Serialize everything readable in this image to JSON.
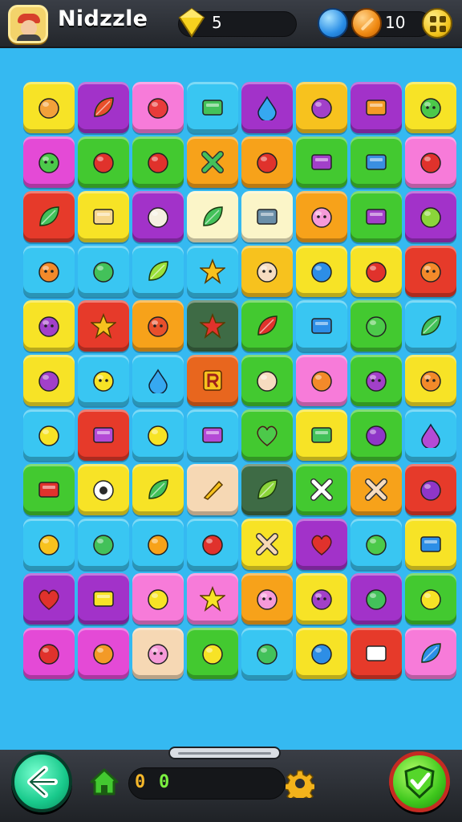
{
  "header": {
    "title": "Nidzzle",
    "gems": "5",
    "coins": "10",
    "avatar_icon": "player-avatar-icon",
    "gem_icon": "yellow-gem-icon",
    "blue_orb_icon": "blue-orb-icon",
    "coin_icon": "coin-icon",
    "menu_icon": "menu-grid-icon"
  },
  "footer": {
    "counter_a": "0",
    "counter_b": "0",
    "back_icon": "back-arrow-icon",
    "home_icon": "home-icon",
    "settings_icon": "gear-icon",
    "confirm_icon": "shield-check-icon"
  },
  "board": {
    "columns": 8,
    "rows": 11,
    "tiles": [
      {
        "bg": "#f7e326",
        "icon": "orange-ring",
        "color": "#f2a13a"
      },
      {
        "bg": "#a232c9",
        "icon": "red-leaf",
        "color": "#e84f2c"
      },
      {
        "bg": "#f77bd9",
        "icon": "red-fruit",
        "color": "#e83b3b"
      },
      {
        "bg": "#39c6f2",
        "icon": "green-card",
        "color": "#43c15a"
      },
      {
        "bg": "#a232c9",
        "icon": "water-drop",
        "color": "#36a8f0"
      },
      {
        "bg": "#f7c21e",
        "icon": "purple-gem",
        "color": "#a240c9"
      },
      {
        "bg": "#a232c9",
        "icon": "orange-bar",
        "color": "#f39a27"
      },
      {
        "bg": "#f7e326",
        "icon": "green-blob",
        "color": "#4cc94a"
      },
      {
        "bg": "#e44ad6",
        "icon": "green-blob",
        "color": "#4cc94a"
      },
      {
        "bg": "#43c930",
        "icon": "red-berry",
        "color": "#e0322c"
      },
      {
        "bg": "#43c930",
        "icon": "red-apple",
        "color": "#e0322c"
      },
      {
        "bg": "#f7a21a",
        "icon": "green-cross",
        "color": "#43c15a"
      },
      {
        "bg": "#f7a21a",
        "icon": "tomato",
        "color": "#e0322c"
      },
      {
        "bg": "#43c930",
        "icon": "purple-ticket",
        "color": "#a240c9"
      },
      {
        "bg": "#43c930",
        "icon": "juice-box",
        "color": "#3a8fe0"
      },
      {
        "bg": "#f77bd9",
        "icon": "red-seed",
        "color": "#e0322c"
      },
      {
        "bg": "#e63a2a",
        "icon": "green-leaf",
        "color": "#43c15a"
      },
      {
        "bg": "#f7e326",
        "icon": "butter-block",
        "color": "#f6d78d"
      },
      {
        "bg": "#a232c9",
        "icon": "garlic",
        "color": "#f5f0e0"
      },
      {
        "bg": "#fbf5c8",
        "icon": "green-leaf",
        "color": "#43c15a"
      },
      {
        "bg": "#fbf5c8",
        "icon": "tin-can",
        "color": "#6b8fa8"
      },
      {
        "bg": "#f7a21a",
        "icon": "pink-pig",
        "color": "#f59ad8"
      },
      {
        "bg": "#43c930",
        "icon": "purple-ticket",
        "color": "#a240c9"
      },
      {
        "bg": "#a232c9",
        "icon": "green-disc",
        "color": "#8bd43a"
      },
      {
        "bg": "#39c6f2",
        "icon": "orange-face",
        "color": "#f38a2a"
      },
      {
        "bg": "#39c6f2",
        "icon": "green-bubble",
        "color": "#43c15a"
      },
      {
        "bg": "#39c6f2",
        "icon": "green-leaf",
        "color": "#9ae03a"
      },
      {
        "bg": "#39c6f2",
        "icon": "gold-star",
        "color": "#f7c21e"
      },
      {
        "bg": "#f7c21e",
        "icon": "egg-face",
        "color": "#f6dcc0"
      },
      {
        "bg": "#f7e326",
        "icon": "blue-bubble",
        "color": "#2d8ee6"
      },
      {
        "bg": "#f7e326",
        "icon": "red-apple",
        "color": "#e0322c"
      },
      {
        "bg": "#e63a2a",
        "icon": "orange-face",
        "color": "#f38a2a"
      },
      {
        "bg": "#f7e326",
        "icon": "purple-blob",
        "color": "#a240c9"
      },
      {
        "bg": "#e63a2a",
        "icon": "gold-star",
        "color": "#f7c21e"
      },
      {
        "bg": "#f7a21a",
        "icon": "red-face",
        "color": "#e8502c"
      },
      {
        "bg": "#3e6b45",
        "icon": "red-star",
        "color": "#e0322c"
      },
      {
        "bg": "#43c930",
        "icon": "red-leaf",
        "color": "#e0322c"
      },
      {
        "bg": "#39c6f2",
        "icon": "envelope",
        "color": "#2d8ee6"
      },
      {
        "bg": "#43c930",
        "icon": "green-apple",
        "color": "#4cc94a"
      },
      {
        "bg": "#39c6f2",
        "icon": "pea-pod",
        "color": "#43c15a"
      },
      {
        "bg": "#f7e326",
        "icon": "purple-berry",
        "color": "#a240c9"
      },
      {
        "bg": "#39c6f2",
        "icon": "yellow-face",
        "color": "#f7e326"
      },
      {
        "bg": "#39c6f2",
        "icon": "water-drop",
        "color": "#36a8f0"
      },
      {
        "bg": "#e8661e",
        "icon": "letter-r",
        "color": "#f7c21e"
      },
      {
        "bg": "#43c930",
        "icon": "mushroom",
        "color": "#f6dcc0"
      },
      {
        "bg": "#f77bd9",
        "icon": "orange-pepper",
        "color": "#f38a2a"
      },
      {
        "bg": "#43c930",
        "icon": "purple-blob",
        "color": "#a240c9"
      },
      {
        "bg": "#f7e326",
        "icon": "orange-face",
        "color": "#f38a2a"
      },
      {
        "bg": "#39c6f2",
        "icon": "yellow-fish",
        "color": "#f7e326"
      },
      {
        "bg": "#e63a2a",
        "icon": "purple-candy",
        "color": "#b44ad6"
      },
      {
        "bg": "#39c6f2",
        "icon": "lemon",
        "color": "#f7e326"
      },
      {
        "bg": "#39c6f2",
        "icon": "purple-card",
        "color": "#b44ad6"
      },
      {
        "bg": "#43c930",
        "icon": "green-heart",
        "color": "#4cc94a"
      },
      {
        "bg": "#f7e326",
        "icon": "green-mail",
        "color": "#43c15a"
      },
      {
        "bg": "#43c930",
        "icon": "eggplant",
        "color": "#8f36c8"
      },
      {
        "bg": "#39c6f2",
        "icon": "purple-drop",
        "color": "#b44ad6"
      },
      {
        "bg": "#43c930",
        "icon": "red-slot",
        "color": "#e0322c"
      },
      {
        "bg": "#f7e326",
        "icon": "eyeball",
        "color": "#ffffff"
      },
      {
        "bg": "#f7e326",
        "icon": "green-leaf",
        "color": "#43c15a"
      },
      {
        "bg": "#f6d8b4",
        "icon": "pencil",
        "color": "#f7c21e"
      },
      {
        "bg": "#3e6b45",
        "icon": "green-leaf",
        "color": "#8bd43a"
      },
      {
        "bg": "#43c930",
        "icon": "white-cross",
        "color": "#ffffff"
      },
      {
        "bg": "#f7a21a",
        "icon": "tools",
        "color": "#f6dcc0"
      },
      {
        "bg": "#e63a2a",
        "icon": "purple-berry",
        "color": "#8f36c8"
      },
      {
        "bg": "#39c6f2",
        "icon": "yellow-ring",
        "color": "#f7c21e"
      },
      {
        "bg": "#39c6f2",
        "icon": "green-lolly",
        "color": "#43c15a"
      },
      {
        "bg": "#39c6f2",
        "icon": "orange-shell",
        "color": "#f7a21a"
      },
      {
        "bg": "#39c6f2",
        "icon": "red-berry",
        "color": "#e0322c"
      },
      {
        "bg": "#f7e326",
        "icon": "bandage-x",
        "color": "#f6d8b4"
      },
      {
        "bg": "#a232c9",
        "icon": "red-heart",
        "color": "#e0322c"
      },
      {
        "bg": "#39c6f2",
        "icon": "green-apple",
        "color": "#4cc94a"
      },
      {
        "bg": "#f7e326",
        "icon": "blue-box",
        "color": "#2d8ee6"
      },
      {
        "bg": "#a232c9",
        "icon": "red-heart",
        "color": "#e0322c"
      },
      {
        "bg": "#a232c9",
        "icon": "yellow-note",
        "color": "#f7e326"
      },
      {
        "bg": "#f77bd9",
        "icon": "lemon",
        "color": "#f7e326"
      },
      {
        "bg": "#f77bd9",
        "icon": "gold-star",
        "color": "#f7e326"
      },
      {
        "bg": "#f7a21a",
        "icon": "pink-pig",
        "color": "#f59ad8"
      },
      {
        "bg": "#f7e326",
        "icon": "purple-blob",
        "color": "#a240c9"
      },
      {
        "bg": "#a232c9",
        "icon": "green-dragonfly",
        "color": "#43c15a"
      },
      {
        "bg": "#43c930",
        "icon": "yellow-bird",
        "color": "#f7e326"
      },
      {
        "bg": "#e44ad6",
        "icon": "strawberry",
        "color": "#e0322c"
      },
      {
        "bg": "#e44ad6",
        "icon": "waffle",
        "color": "#f39a27"
      },
      {
        "bg": "#f6d8b4",
        "icon": "pink-pig",
        "color": "#f59ad8"
      },
      {
        "bg": "#43c930",
        "icon": "yellow-cup",
        "color": "#f7e326"
      },
      {
        "bg": "#39c6f2",
        "icon": "green-clover",
        "color": "#43c15a"
      },
      {
        "bg": "#f7e326",
        "icon": "blue-bubble",
        "color": "#2d8ee6"
      },
      {
        "bg": "#e63a2a",
        "icon": "gift-box",
        "color": "#ffffff"
      },
      {
        "bg": "#f77bd9",
        "icon": "blue-leaf",
        "color": "#2d8ee6"
      }
    ]
  }
}
